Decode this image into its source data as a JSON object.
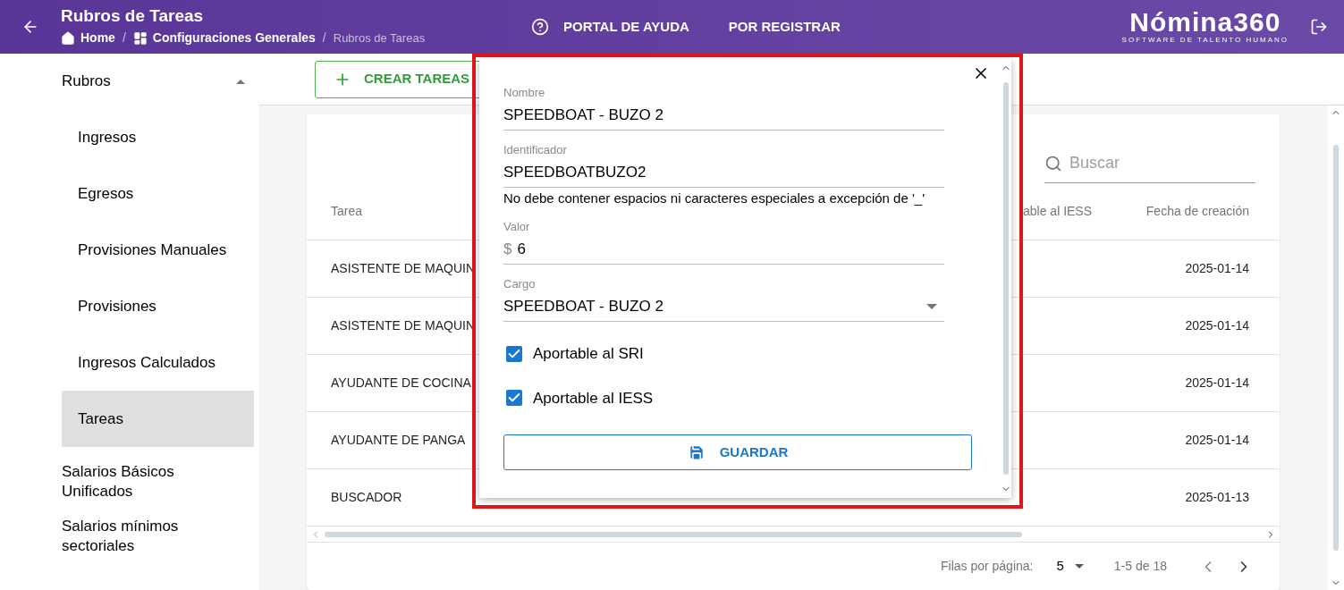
{
  "header": {
    "title": "Rubros de Tareas",
    "breadcrumbs": [
      {
        "label": "Home"
      },
      {
        "separator": "/",
        "label": "Configuraciones Generales"
      },
      {
        "separator": "/",
        "label": "Rubros de Tareas"
      }
    ],
    "nav_links": [
      {
        "label": "PORTAL DE AYUDA"
      },
      {
        "label": "POR REGISTRAR"
      }
    ],
    "logo": {
      "name": "Nómina360",
      "tagline": "SOFTWARE DE TALENTO HUMANO"
    }
  },
  "sidebar": {
    "group": {
      "label": "Rubros",
      "expanded": true,
      "children": [
        {
          "label": "Ingresos",
          "selected": false
        },
        {
          "label": "Egresos",
          "selected": false
        },
        {
          "label": "Provisiones Manuales",
          "selected": false
        },
        {
          "label": "Provisiones",
          "selected": false
        },
        {
          "label": "Ingresos Calculados",
          "selected": false
        },
        {
          "label": "Tareas",
          "selected": true
        }
      ]
    },
    "items": [
      {
        "label": "Salarios Básicos Unificados"
      },
      {
        "label": "Salarios mínimos sectoriales"
      }
    ]
  },
  "create_button": "CREAR TAREAS",
  "search": {
    "placeholder": "Buscar"
  },
  "table": {
    "columns": [
      "Tarea",
      "able al IESS",
      "Fecha de creación"
    ],
    "rows": [
      {
        "tarea": "ASISTENTE DE MAQUIN",
        "fecha": "2025-01-14"
      },
      {
        "tarea": "ASISTENTE DE MAQUIN",
        "fecha": "2025-01-14"
      },
      {
        "tarea": "AYUDANTE DE COCINA",
        "fecha": "2025-01-14"
      },
      {
        "tarea": "AYUDANTE DE PANGA",
        "fecha": "2025-01-14"
      },
      {
        "tarea": "BUSCADOR",
        "fecha": "2025-01-13"
      }
    ]
  },
  "pagination": {
    "rows_per_page_label": "Filas por página:",
    "rows_per_page": "5",
    "range": "1-5 de 18"
  },
  "dialog": {
    "fields": [
      {
        "kind": "text",
        "label": "Nombre",
        "value": "SPEEDBOAT - BUZO 2"
      },
      {
        "kind": "text",
        "label": "Identificador",
        "value": "SPEEDBOATBUZO2",
        "helper": "No debe contener espacios ni caracteres especiales a excepción de '_'"
      },
      {
        "kind": "money",
        "label": "Valor",
        "prefix": "$",
        "value": "6"
      },
      {
        "kind": "select",
        "label": "Cargo",
        "value": "SPEEDBOAT - BUZO 2"
      }
    ],
    "checkboxes": [
      {
        "label": "Aportable al SRI",
        "checked": true
      },
      {
        "label": "Aportable al IESS",
        "checked": true
      }
    ],
    "save_button": "GUARDAR"
  }
}
